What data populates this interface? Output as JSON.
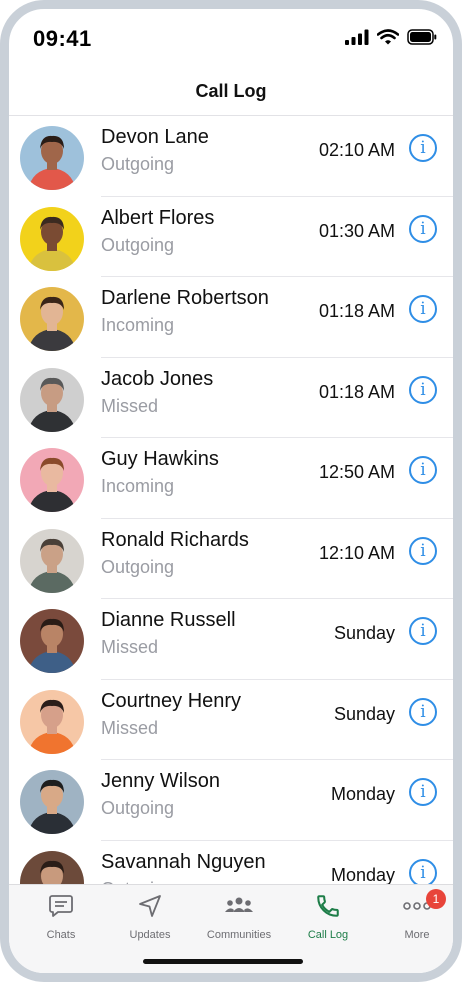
{
  "status_bar": {
    "time": "09:41"
  },
  "header": {
    "title": "Call Log"
  },
  "calls": [
    {
      "name": "Devon Lane",
      "type": "Outgoing",
      "time": "02:10 AM",
      "bg": "#9ec1db",
      "shirt": "#e2584a",
      "skin": "#a0664a",
      "hair": "#2a1d17"
    },
    {
      "name": "Albert Flores",
      "type": "Outgoing",
      "time": "01:30 AM",
      "bg": "#f2d21b",
      "shirt": "#d9c13e",
      "skin": "#7a4b33",
      "hair": "#3b2a20"
    },
    {
      "name": "Darlene Robertson",
      "type": "Incoming",
      "time": "01:18 AM",
      "bg": "#e3b74a",
      "shirt": "#3b3a3e",
      "skin": "#e2b594",
      "hair": "#3a2518"
    },
    {
      "name": "Jacob Jones",
      "type": "Missed",
      "time": "01:18 AM",
      "bg": "#cfcfcf",
      "shirt": "#2f3134",
      "skin": "#c79c83",
      "hair": "#595959"
    },
    {
      "name": "Guy Hawkins",
      "type": "Incoming",
      "time": "12:50 AM",
      "bg": "#f2a8b6",
      "shirt": "#2e2f33",
      "skin": "#e9b9a0",
      "hair": "#8a4a2a"
    },
    {
      "name": "Ronald Richards",
      "type": "Outgoing",
      "time": "12:10 AM",
      "bg": "#d7d4cf",
      "shirt": "#5b6a62",
      "skin": "#caa187",
      "hair": "#4a4038"
    },
    {
      "name": "Dianne Russell",
      "type": "Missed",
      "time": "Sunday",
      "bg": "#7a4a3c",
      "shirt": "#3e5f87",
      "skin": "#b98466",
      "hair": "#2a1c16"
    },
    {
      "name": "Courtney Henry",
      "type": "Missed",
      "time": "Sunday",
      "bg": "#f6c7a6",
      "shirt": "#f0742f",
      "skin": "#d6a08a",
      "hair": "#2b1e1a"
    },
    {
      "name": "Jenny Wilson",
      "type": "Outgoing",
      "time": "Monday",
      "bg": "#9fb3c3",
      "shirt": "#2a2f36",
      "skin": "#d8a987",
      "hair": "#1e1e1e"
    },
    {
      "name": "Savannah Nguyen",
      "type": "Outgoing",
      "time": "Monday",
      "bg": "#6c4a3a",
      "shirt": "#7d5a44",
      "skin": "#c89a7d",
      "hair": "#2a1d17"
    }
  ],
  "info_glyph": "i",
  "tabs": [
    {
      "label": "Chats",
      "icon": "chat-icon"
    },
    {
      "label": "Updates",
      "icon": "navigation-icon"
    },
    {
      "label": "Communities",
      "icon": "communities-icon"
    },
    {
      "label": "Call Log",
      "icon": "phone-icon"
    },
    {
      "label": "More",
      "icon": "more-icon"
    }
  ],
  "more_badge": "1",
  "colors": {
    "accent_green": "#1d7d48",
    "info_blue": "#2f8ee6",
    "badge_red": "#e8443a"
  }
}
